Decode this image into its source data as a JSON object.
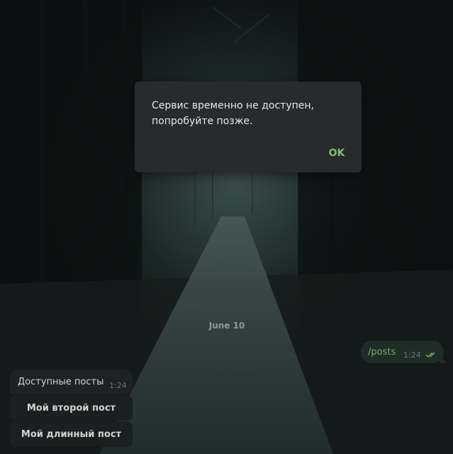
{
  "dialog": {
    "message": "Сервис временно не доступен, попробуйте позже.",
    "ok_label": "OK"
  },
  "chat": {
    "date_separator": "June 10",
    "outgoing": {
      "text": "/posts",
      "time": "1:24",
      "status_icon": "double-check-icon"
    },
    "incoming": {
      "text": "Доступные посты",
      "time": "1:24"
    },
    "inline_buttons": [
      "Мой второй пост",
      "Мой длинный пост"
    ]
  },
  "colors": {
    "accent": "#7ac274",
    "dialog_bg": "#282a2e",
    "outgoing_bubble": "#1f2c27",
    "incoming_bubble": "#1e2223"
  }
}
